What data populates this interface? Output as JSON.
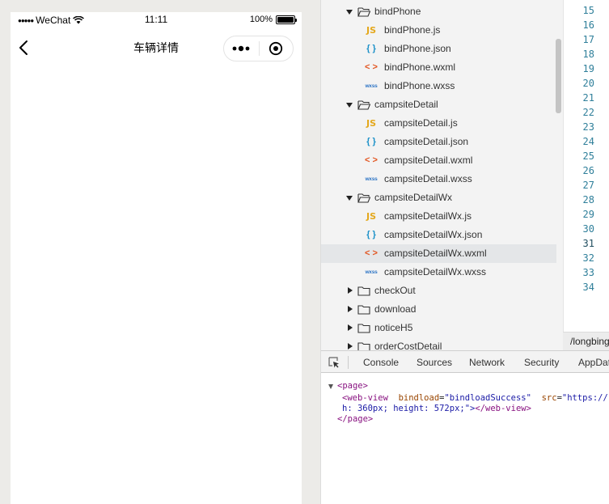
{
  "status_bar": {
    "signal_dots": "●●●●●",
    "carrier": "WeChat",
    "time": "11:11",
    "battery": "100%"
  },
  "navbar": {
    "title": "车辆详情",
    "more_glyph": "•••"
  },
  "file_tree": [
    {
      "type": "folder",
      "open": true,
      "label": "bindPhone",
      "indent": 0
    },
    {
      "type": "js",
      "icon": "JS",
      "label": "bindPhone.js",
      "indent": 1
    },
    {
      "type": "json",
      "icon": "{ }",
      "label": "bindPhone.json",
      "indent": 1
    },
    {
      "type": "wxml",
      "icon": "< >",
      "label": "bindPhone.wxml",
      "indent": 1
    },
    {
      "type": "wxss",
      "icon": "wxss",
      "label": "bindPhone.wxss",
      "indent": 1
    },
    {
      "type": "folder",
      "open": true,
      "label": "campsiteDetail",
      "indent": 0
    },
    {
      "type": "js",
      "icon": "JS",
      "label": "campsiteDetail.js",
      "indent": 1
    },
    {
      "type": "json",
      "icon": "{ }",
      "label": "campsiteDetail.json",
      "indent": 1
    },
    {
      "type": "wxml",
      "icon": "< >",
      "label": "campsiteDetail.wxml",
      "indent": 1
    },
    {
      "type": "wxss",
      "icon": "wxss",
      "label": "campsiteDetail.wxss",
      "indent": 1
    },
    {
      "type": "folder",
      "open": true,
      "label": "campsiteDetailWx",
      "indent": 0
    },
    {
      "type": "js",
      "icon": "JS",
      "label": "campsiteDetailWx.js",
      "indent": 1
    },
    {
      "type": "json",
      "icon": "{ }",
      "label": "campsiteDetailWx.json",
      "indent": 1
    },
    {
      "type": "wxml",
      "icon": "< >",
      "label": "campsiteDetailWx.wxml",
      "indent": 1,
      "selected": true
    },
    {
      "type": "wxss",
      "icon": "wxss",
      "label": "campsiteDetailWx.wxss",
      "indent": 1
    },
    {
      "type": "folder",
      "open": false,
      "label": "checkOut",
      "indent": 0
    },
    {
      "type": "folder",
      "open": false,
      "label": "download",
      "indent": 0
    },
    {
      "type": "folder",
      "open": false,
      "label": "noticeH5",
      "indent": 0
    },
    {
      "type": "folder",
      "open": false,
      "label": "orderCostDetail",
      "indent": 0
    }
  ],
  "line_numbers": [
    "15",
    "16",
    "17",
    "18",
    "19",
    "20",
    "21",
    "22",
    "23",
    "24",
    "25",
    "26",
    "27",
    "28",
    "29",
    "30",
    "31",
    "32",
    "33",
    "34"
  ],
  "current_line": "31",
  "path_bar": "/longbing",
  "devtools": {
    "tabs": [
      "Console",
      "Sources",
      "Network",
      "Security",
      "AppData"
    ],
    "dom": {
      "page_open": "<page>",
      "webview_tag_open": "<web-view",
      "attr1_name": "bindload",
      "attr1_value": "\"bindloadSuccess\"",
      "attr2_name": "src",
      "attr2_value": "\"https://",
      "line2_text": "h: 360px; height: 572px;\">",
      "webview_close": "</web-view>",
      "page_close": "</page>"
    }
  },
  "colors": {
    "js_icon": "#e4a81c",
    "json_icon": "#1a90c8",
    "wxml_icon": "#e2541f",
    "wxss_icon": "#2c74c5",
    "line_number": "#2f7f9a",
    "dom_tag": "#881280",
    "dom_attr": "#994500",
    "dom_value": "#1a1aa6"
  }
}
